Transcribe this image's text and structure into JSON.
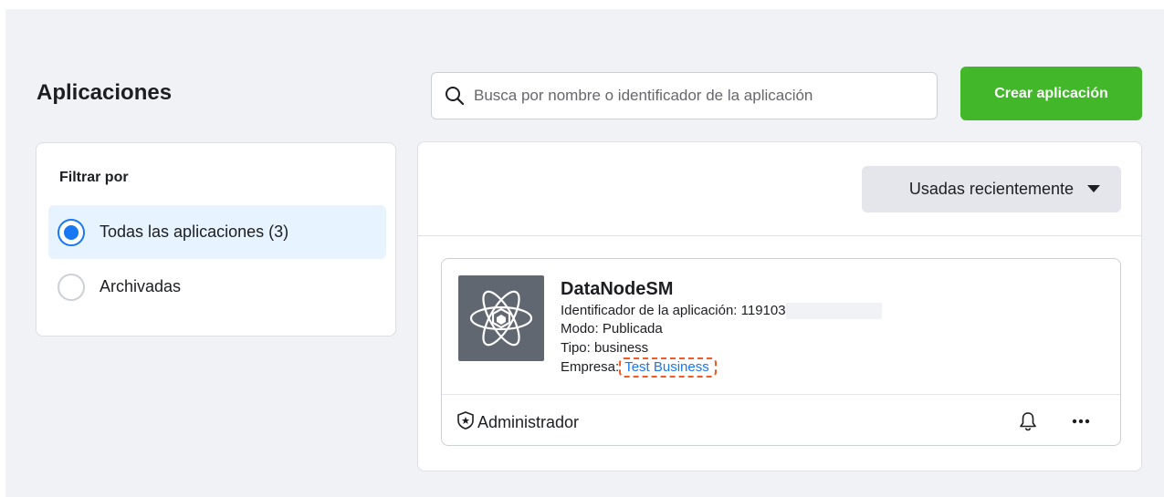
{
  "page": {
    "title": "Aplicaciones"
  },
  "search": {
    "placeholder": "Busca por nombre o identificador de la aplicación",
    "value": ""
  },
  "actions": {
    "create_label": "Crear aplicación"
  },
  "filter": {
    "title": "Filtrar por",
    "options": [
      {
        "label": "Todas las aplicaciones (3)",
        "selected": true
      },
      {
        "label": "Archivadas",
        "selected": false
      }
    ]
  },
  "sort": {
    "label": "Usadas recientemente"
  },
  "app": {
    "name": "DataNodeSM",
    "id_label": "Identificador de la aplicación: ",
    "id_value": "119103",
    "mode_label": "Modo: Publicada",
    "type_label": "Tipo: business",
    "business_label": "Empresa:",
    "business_name": "Test Business",
    "role": "Administrador"
  },
  "colors": {
    "accent_blue": "#1877f2",
    "create_green": "#42b72a",
    "highlight_orange": "#f05a24",
    "background": "#f0f2f5"
  },
  "icons": [
    "search-icon",
    "radio-icon",
    "caret-down-icon",
    "app-atom-icon",
    "admin-shield-icon",
    "bell-icon",
    "more-icon"
  ]
}
